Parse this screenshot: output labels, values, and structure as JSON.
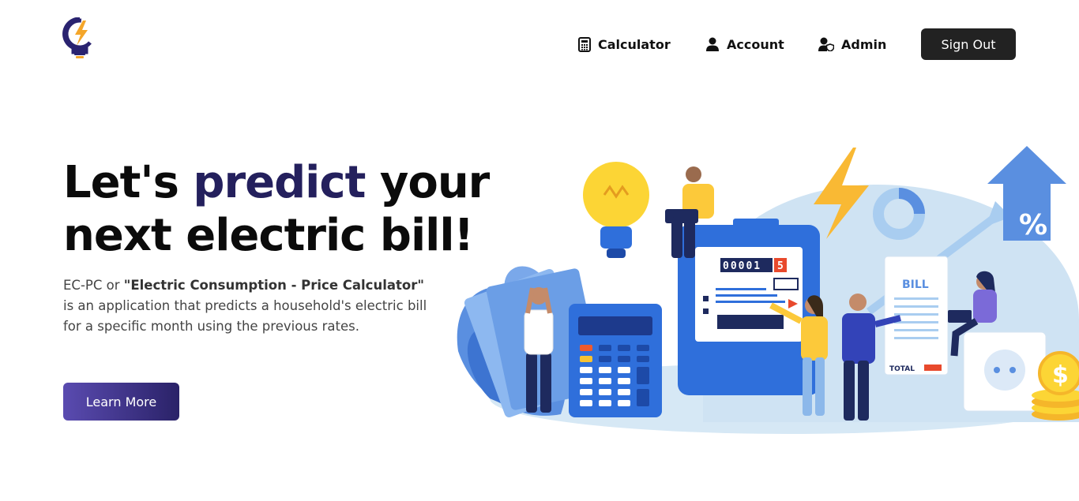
{
  "header": {
    "nav": {
      "calculator": "Calculator",
      "account": "Account",
      "admin": "Admin"
    },
    "sign_out": "Sign Out"
  },
  "hero": {
    "headline_part1": "Let's ",
    "headline_accent": "predict",
    "headline_part2": " your next electric bill!",
    "desc_prefix": "EC-PC or ",
    "desc_bold": "\"Electric Consumption - Price Calculator\"",
    "desc_suffix": " is an application that predicts a household's electric bill for a specific month using the previous rates.",
    "learn_more": "Learn More"
  },
  "illustration": {
    "meter_digits": "00001",
    "meter_red_digit": "5",
    "bill_title": "BILL",
    "bill_total": "TOTAL",
    "percent_sign": "%",
    "coin_symbol": "$"
  },
  "colors": {
    "accent": "#24205d",
    "button_dark": "#222222",
    "learn_gradient_start": "#5a4bb0",
    "learn_gradient_end": "#2a2268",
    "illustration_blue": "#2f6fdb",
    "illustration_light_blue": "#bcdcf2",
    "bulb_yellow": "#fcd535"
  }
}
